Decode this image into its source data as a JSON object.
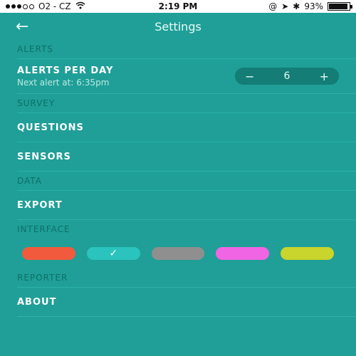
{
  "status": {
    "carrier": "O2 - CZ",
    "time": "2:19 PM",
    "battery": "93%",
    "signal_bars_filled": 3,
    "signal_bars_total": 5,
    "battery_level": 0.93
  },
  "header": {
    "title": "Settings",
    "back_icon": "arrow-left-icon",
    "back_glyph": "←"
  },
  "alerts": {
    "header": "ALERTS",
    "per_day_label": "ALERTS PER DAY",
    "next_alert": "Next alert at: 6:35pm",
    "minus": "−",
    "value": "6",
    "plus": "+"
  },
  "survey": {
    "header": "SURVEY",
    "items": [
      {
        "label": "QUESTIONS"
      },
      {
        "label": "SENSORS"
      }
    ]
  },
  "data_section": {
    "header": "DATA",
    "items": [
      {
        "label": "EXPORT"
      }
    ]
  },
  "interface": {
    "header": "INTERFACE",
    "selected_check": "✓",
    "colors": [
      "#f15a3d",
      "#2bc3bd",
      "#8f8f8f",
      "#f065e3",
      "#c9d42c"
    ],
    "selected_index": 1
  },
  "reporter": {
    "header": "REPORTER",
    "items": [
      {
        "label": "ABOUT"
      }
    ]
  }
}
